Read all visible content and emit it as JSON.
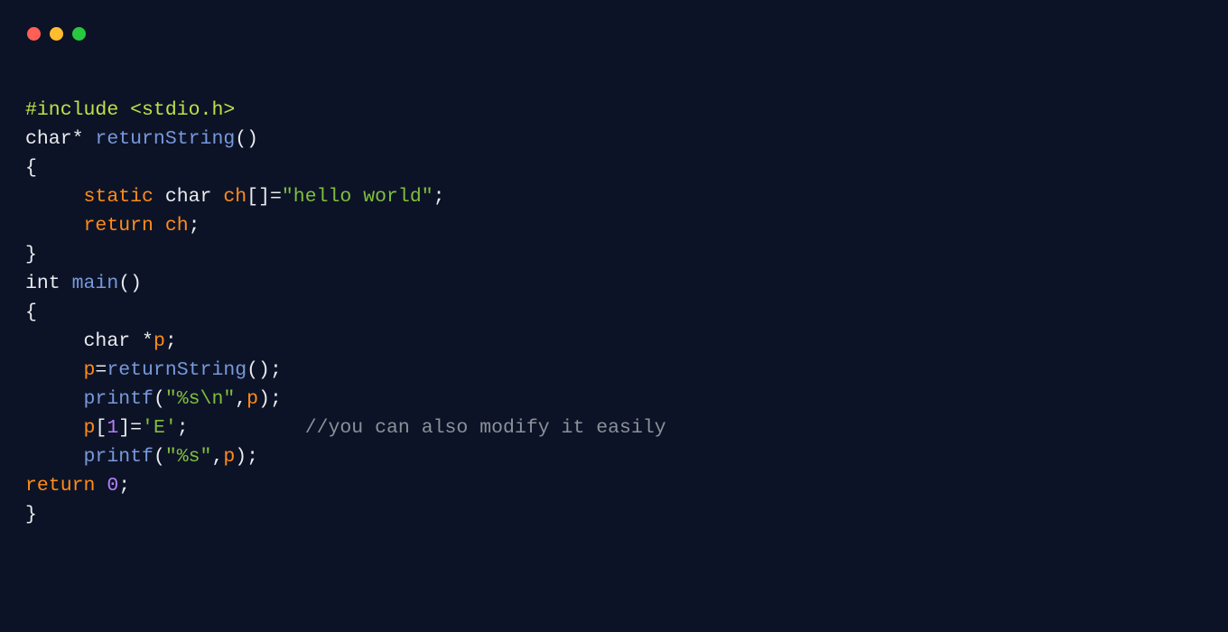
{
  "titlebar": {
    "dots": [
      "red",
      "yellow",
      "green"
    ]
  },
  "tokens": {
    "l1_directive": "#include",
    "l1_header": "<stdio.h>",
    "l2_type": "char",
    "l2_ptr": "*",
    "l2_func": "returnString",
    "l2_paren": "()",
    "l3_brace": "{",
    "l4_kw": "static",
    "l4_type": "char",
    "l4_ident": "ch",
    "l4_brackets": "[]=",
    "l4_str": "\"hello world\"",
    "l4_semi": ";",
    "l5_kw": "return",
    "l5_ident": "ch",
    "l5_semi": ";",
    "l6_brace": "}",
    "l7_type": "int",
    "l7_func": "main",
    "l7_paren": "()",
    "l8_brace": "{",
    "l9_type": "char",
    "l9_ptr": "*",
    "l9_ident": "p",
    "l9_semi": ";",
    "l10_ident": "p",
    "l10_eq": "=",
    "l10_func": "returnString",
    "l10_paren": "();",
    "l11_func": "printf",
    "l11_open": "(",
    "l11_str": "\"%s\\n\"",
    "l11_comma": ",",
    "l11_ident": "p",
    "l11_close": ");",
    "l12_ident": "p",
    "l12_open": "[",
    "l12_num": "1",
    "l12_close": "]=",
    "l12_char": "'E'",
    "l12_semi": ";",
    "l12_comment": "//you can also modify it easily",
    "l13_func": "printf",
    "l13_open": "(",
    "l13_str": "\"%s\"",
    "l13_comma": ",",
    "l13_ident": "p",
    "l13_close": ");",
    "l14_kw": "return",
    "l14_num": "0",
    "l14_semi": ";",
    "l15_brace": "}"
  }
}
